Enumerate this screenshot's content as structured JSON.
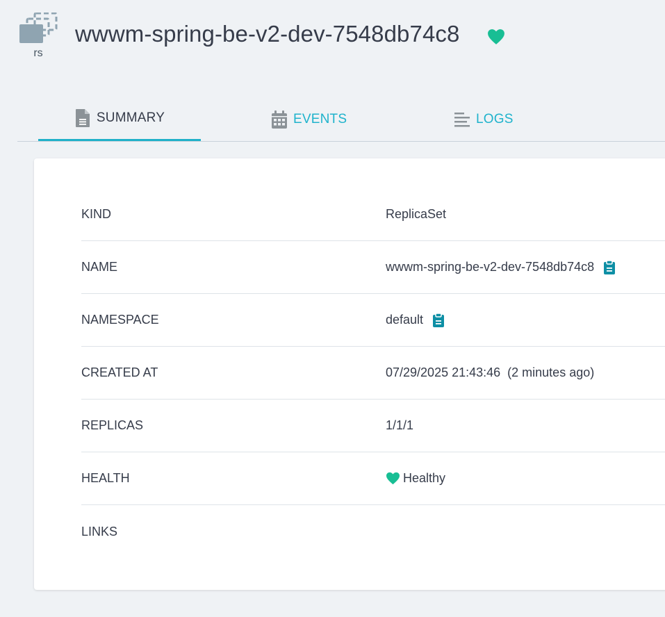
{
  "header": {
    "kind_abbrev": "rs",
    "title": "wwwm-spring-be-v2-dev-7548db74c8",
    "health_icon": "heart-icon",
    "health_color": "#18be94"
  },
  "tabs": [
    {
      "label": "SUMMARY",
      "icon": "document-icon",
      "active": true
    },
    {
      "label": "EVENTS",
      "icon": "calendar-icon",
      "active": false
    },
    {
      "label": "LOGS",
      "icon": "lines-icon",
      "active": false
    }
  ],
  "summary": {
    "rows": [
      {
        "label": "KIND",
        "value": "ReplicaSet"
      },
      {
        "label": "NAME",
        "value": "wwwm-spring-be-v2-dev-7548db74c8",
        "copy": true
      },
      {
        "label": "NAMESPACE",
        "value": "default",
        "copy": true
      },
      {
        "label": "CREATED AT",
        "value": "07/29/2025 21:43:46  (2 minutes ago)"
      },
      {
        "label": "REPLICAS",
        "value": "1/1/1"
      },
      {
        "label": "HEALTH",
        "value": "Healthy"
      },
      {
        "label": "LINKS",
        "value": ""
      }
    ]
  },
  "colors": {
    "accent": "#1fb3cc",
    "copy_icon": "#0e8fa5",
    "background": "#eff2f5"
  }
}
